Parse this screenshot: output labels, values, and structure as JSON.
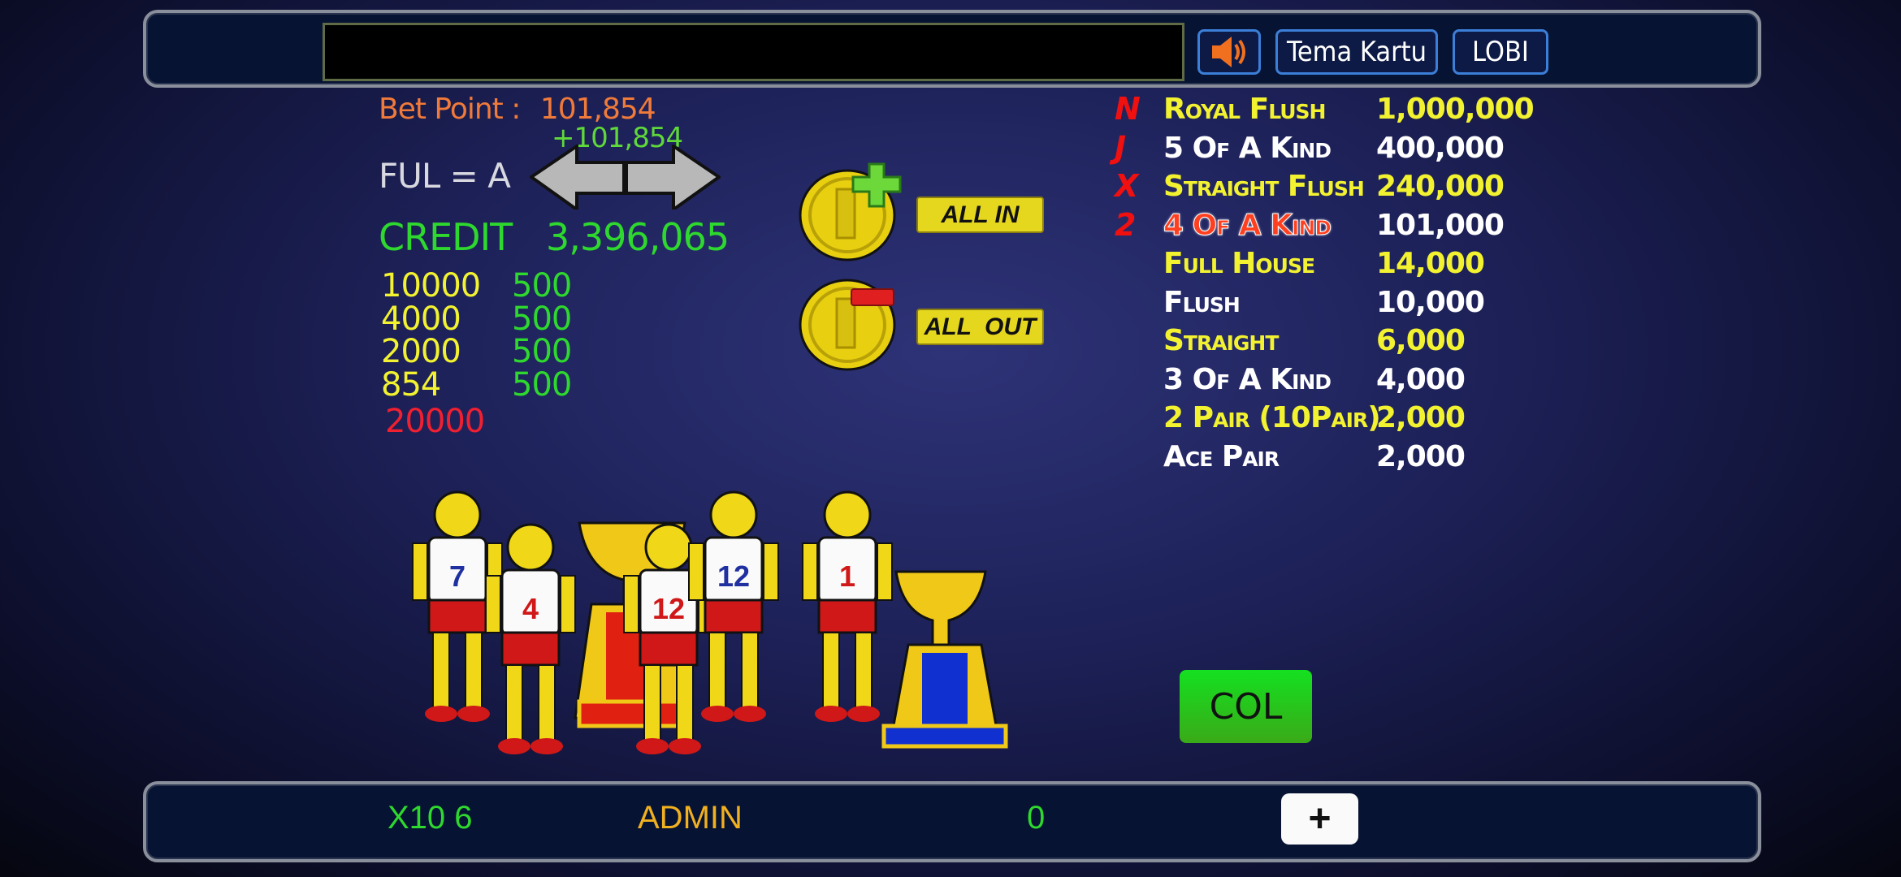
{
  "header": {
    "message": "",
    "sound_icon": "speaker-icon",
    "theme_button": "Tema Kartu",
    "lobby_button": "LOBI"
  },
  "bet": {
    "label": "Bet Point :",
    "value": "101,854",
    "delta": "+101,854",
    "ful_label": "FUL = A"
  },
  "credit": {
    "label": "CREDIT",
    "value": "3,396,065"
  },
  "chips": [
    {
      "amount": "10000",
      "count": "500"
    },
    {
      "amount": "4000",
      "count": "500"
    },
    {
      "amount": "2000",
      "count": "500"
    },
    {
      "amount": "854",
      "count": "500"
    }
  ],
  "chips_total": "20000",
  "actions": {
    "all_in": "ALL IN",
    "all_out": "ALL  OUT",
    "collect": "COL"
  },
  "paytable": [
    {
      "letter": "N",
      "name": "Royal Flush",
      "value": "1,000,000",
      "color": "#f2f230"
    },
    {
      "letter": "J",
      "name": "5 Of A Kind",
      "value": "400,000",
      "color": "#ffffff"
    },
    {
      "letter": "X",
      "name": "Straight Flush",
      "value": "240,000",
      "color": "#f2f230"
    },
    {
      "letter": "2",
      "name": "4 Of A Kind",
      "value": "101,000",
      "color": "#ff4020",
      "value_color": "#ffffff",
      "highlighted": true
    },
    {
      "letter": "",
      "name": "Full House",
      "value": "14,000",
      "color": "#f2f230"
    },
    {
      "letter": "",
      "name": "Flush",
      "value": "10,000",
      "color": "#ffffff"
    },
    {
      "letter": "",
      "name": "Straight",
      "value": "6,000",
      "color": "#f2f230"
    },
    {
      "letter": "",
      "name": "3 Of A Kind",
      "value": "4,000",
      "color": "#ffffff"
    },
    {
      "letter": "",
      "name": "2 Pair (10Pair)",
      "value": "2,000",
      "color": "#f2f230"
    },
    {
      "letter": "",
      "name": "Ace Pair",
      "value": "2,000",
      "color": "#ffffff"
    }
  ],
  "footer": {
    "multiplier": "X10 6",
    "user": "ADMIN",
    "score": "0",
    "plus_button": "+"
  },
  "colors": {
    "green": "#2ed82e",
    "yellow": "#f2f230",
    "orange": "#f07a3a",
    "red": "#f02030",
    "admin": "#f0b020"
  }
}
